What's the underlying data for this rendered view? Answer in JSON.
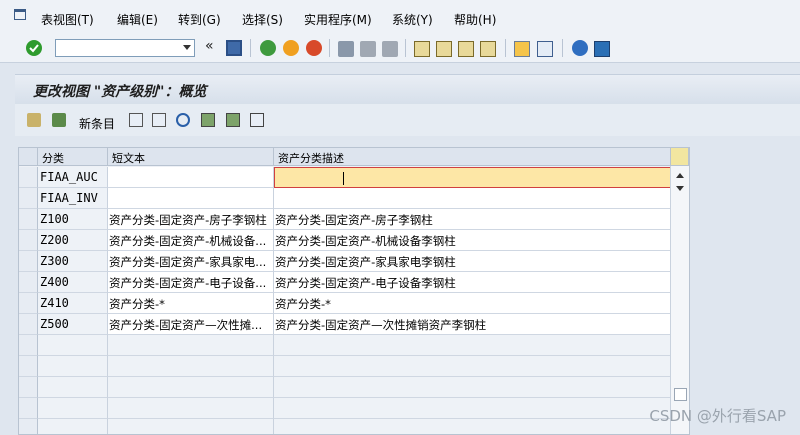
{
  "menu": [
    "表视图(T)",
    "编辑(E)",
    "转到(G)",
    "选择(S)",
    "实用程序(M)",
    "系统(Y)",
    "帮助(H)"
  ],
  "toolbar": {
    "command_value": "",
    "history_glyph": "«"
  },
  "title": "更改视图 \"资产级别\"：概览",
  "app_toolbar": {
    "new_entries": "新条目"
  },
  "table": {
    "columns": [
      "分类",
      "短文本",
      "资产分类描述"
    ],
    "rows": [
      {
        "key": "FIAA_AUC",
        "short": "",
        "desc": ""
      },
      {
        "key": "FIAA_INV",
        "short": "",
        "desc": ""
      },
      {
        "key": "Z100",
        "short": "资产分类-固定资产-房子李钢柱",
        "desc": "资产分类-固定资产-房子李钢柱"
      },
      {
        "key": "Z200",
        "short": "资产分类-固定资产-机械设备...",
        "desc": "资产分类-固定资产-机械设备李钢柱"
      },
      {
        "key": "Z300",
        "short": "资产分类-固定资产-家具家电...",
        "desc": "资产分类-固定资产-家具家电李钢柱"
      },
      {
        "key": "Z400",
        "short": "资产分类-固定资产-电子设备...",
        "desc": "资产分类-固定资产-电子设备李钢柱"
      },
      {
        "key": "Z410",
        "short": "资产分类-*",
        "desc": "资产分类-*"
      },
      {
        "key": "Z500",
        "short": "资产分类-固定资产—次性摊...",
        "desc": "资产分类-固定资产—次性摊销资产李钢柱"
      }
    ]
  },
  "watermark": "CSDN @外行看SAP",
  "colors": {
    "focus_cell": "#fde7a6",
    "title_bg": "#d6dfea",
    "accent_green": "#2e9b2e"
  }
}
